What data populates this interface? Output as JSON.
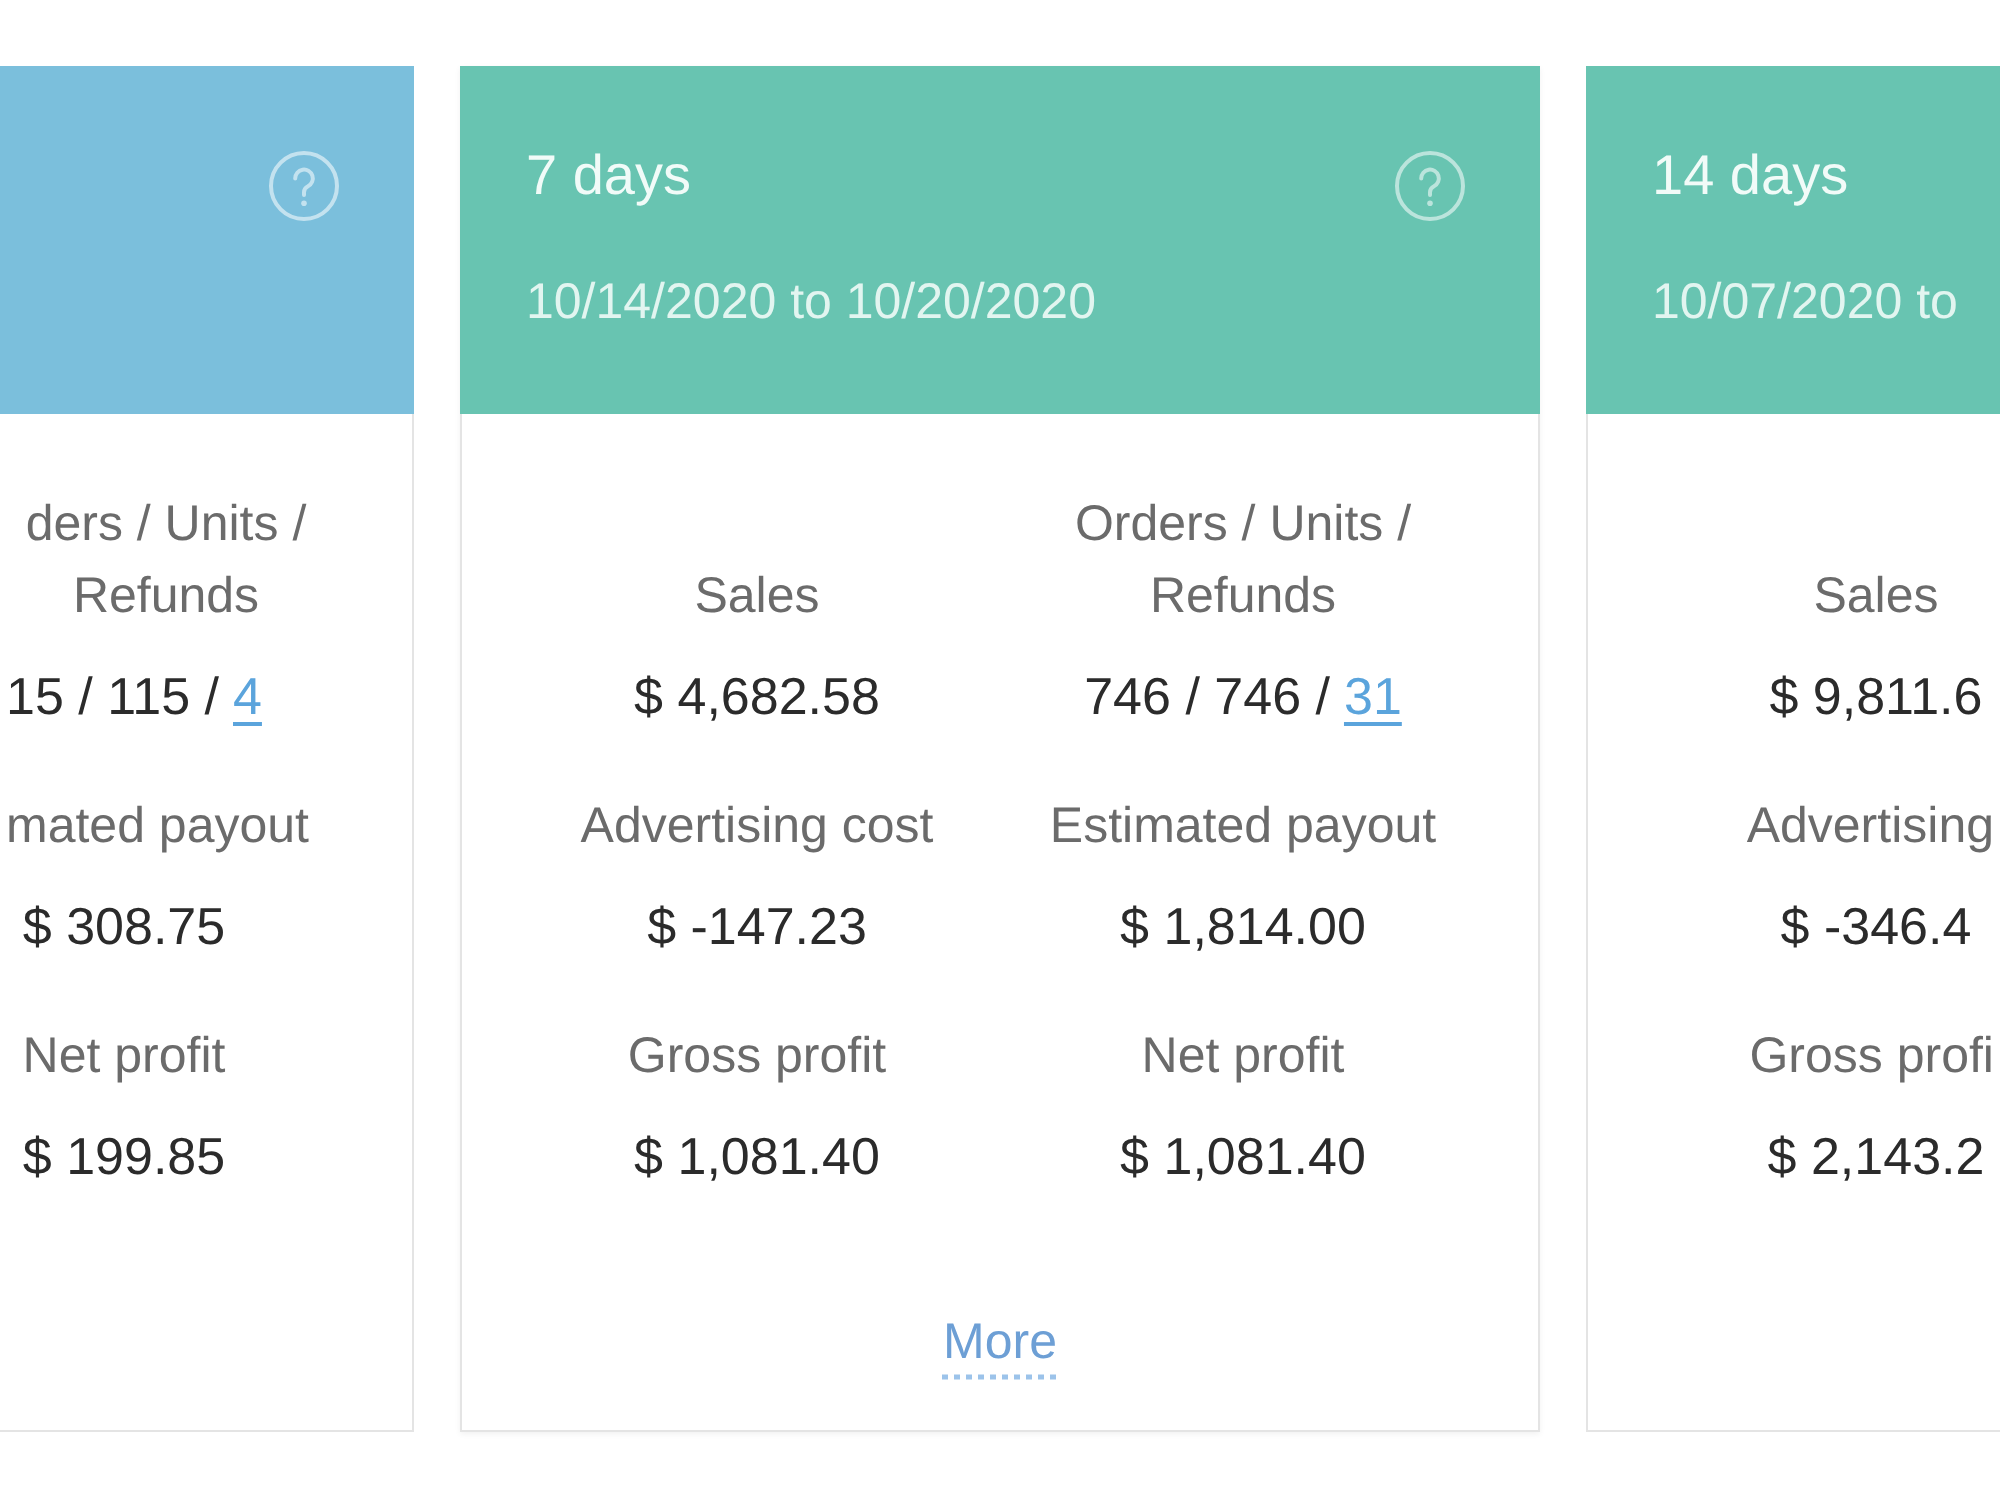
{
  "cards": [
    {
      "color": "#7bbfdc",
      "rows": [
        {
          "right": {
            "label": "ders / Units / Refunds",
            "value": "15 / 115 /",
            "link": "4"
          }
        },
        {
          "right": {
            "label": "mated payout",
            "value": "$ 308.75"
          }
        },
        {
          "right": {
            "label": "Net profit",
            "value": "$ 199.85"
          }
        }
      ]
    },
    {
      "title": "7 days",
      "date_range": "10/14/2020 to 10/20/2020",
      "color": "#68c4b1",
      "rows": [
        {
          "left": {
            "label": "Sales",
            "value": "$ 4,682.58"
          },
          "right": {
            "label": "Orders / Units / Refunds",
            "value": "746 / 746 /",
            "link": "31"
          }
        },
        {
          "left": {
            "label": "Advertising cost",
            "value": "$ -147.23"
          },
          "right": {
            "label": "Estimated payout",
            "value": "$ 1,814.00"
          }
        },
        {
          "left": {
            "label": "Gross profit",
            "value": "$ 1,081.40"
          },
          "right": {
            "label": "Net profit",
            "value": "$ 1,081.40"
          }
        }
      ],
      "more_link": "More"
    },
    {
      "title": "14 days",
      "date_range": "10/07/2020 to",
      "color": "#68c4b1",
      "rows": [
        {
          "left": {
            "label": "Sales",
            "value": "$ 9,811.6"
          }
        },
        {
          "left": {
            "label": "Advertising",
            "value": "$ -346.4"
          }
        },
        {
          "left": {
            "label": "Gross profi",
            "value": "$ 2,143.2"
          }
        }
      ]
    }
  ]
}
